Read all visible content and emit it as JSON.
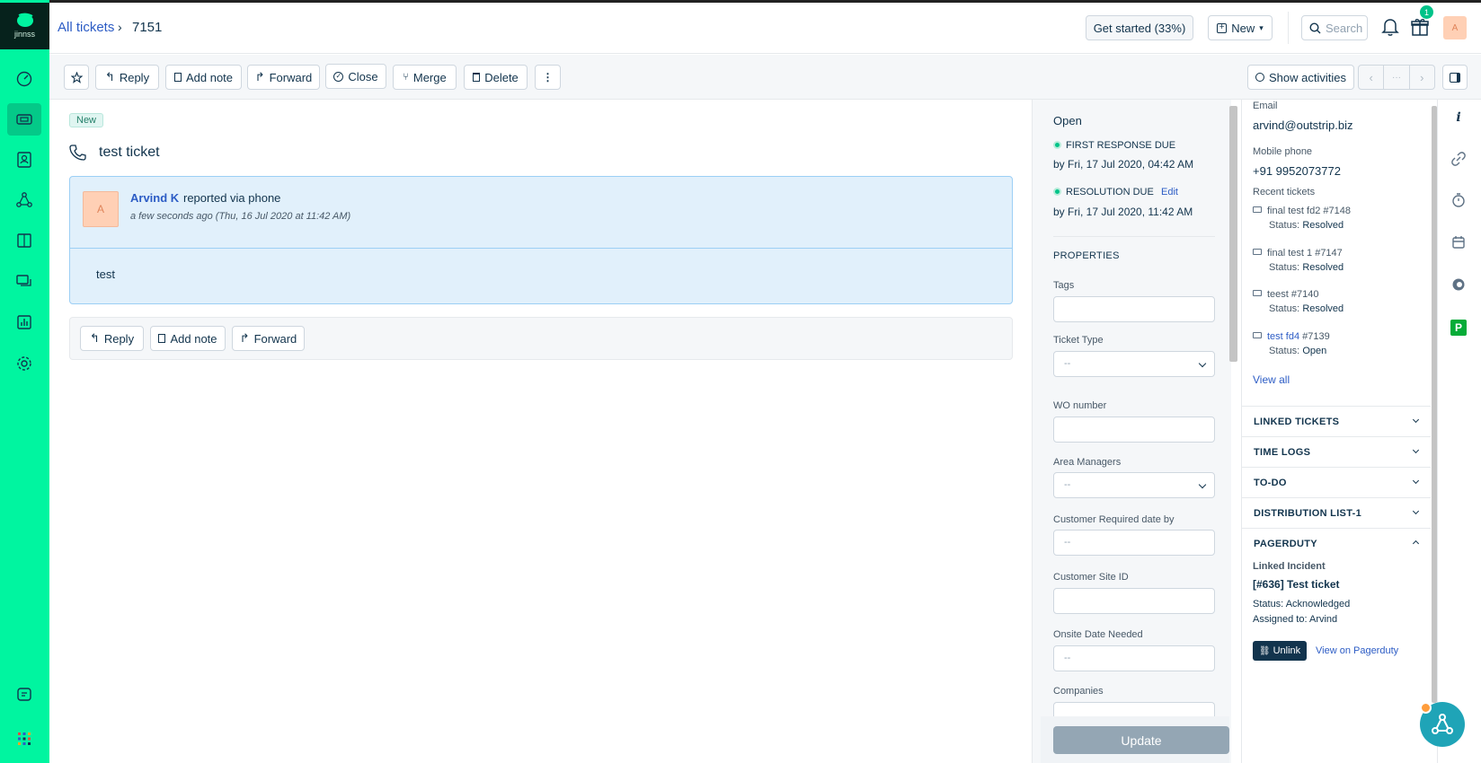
{
  "logo": {
    "text": "jinnss"
  },
  "header": {
    "breadcrumb_root": "All tickets",
    "breadcrumb_current": "7151",
    "get_started": "Get started (33%)",
    "new_label": "New",
    "search_placeholder": "Search",
    "gift_badge": "1",
    "avatar": "A"
  },
  "toolbar": {
    "reply": "Reply",
    "add_note": "Add note",
    "forward": "Forward",
    "close": "Close",
    "merge": "Merge",
    "delete": "Delete",
    "show_activities": "Show activities",
    "pager_middle": "···"
  },
  "ticket": {
    "status_badge": "New",
    "subject": "test ticket",
    "requester": "Arvind K",
    "reported_via": "reported via phone",
    "time": "a few seconds ago (Thu, 16 Jul 2020 at 11:42 AM)",
    "avatar": "A",
    "body": "test"
  },
  "reply_bar": {
    "reply": "Reply",
    "add_note": "Add note",
    "forward": "Forward"
  },
  "properties": {
    "status": "Open",
    "first_response_label": "FIRST RESPONSE DUE",
    "first_response_value": "by Fri, 17 Jul 2020, 04:42 AM",
    "resolution_label": "RESOLUTION DUE",
    "resolution_edit": "Edit",
    "resolution_value": "by Fri, 17 Jul 2020, 11:42 AM",
    "section_title": "PROPERTIES",
    "tags_label": "Tags",
    "ticket_type_label": "Ticket Type",
    "ticket_type_value": "--",
    "wo_label": "WO number",
    "area_label": "Area Managers",
    "area_value": "--",
    "crd_label": "Customer Required date by",
    "crd_value": "--",
    "site_label": "Customer Site ID",
    "onsite_label": "Onsite Date Needed",
    "onsite_value": "--",
    "companies_label": "Companies",
    "update": "Update"
  },
  "contact": {
    "email_label": "Email",
    "email": "arvind@outstrip.biz",
    "mobile_label": "Mobile phone",
    "mobile": "+91 9952073772",
    "recent_label": "Recent tickets",
    "status_prefix": "Status:",
    "recent": [
      {
        "title": "final test fd2 #7148",
        "link": "",
        "id": "",
        "status": "Resolved"
      },
      {
        "title": "final test 1 #7147",
        "link": "",
        "id": "",
        "status": "Resolved"
      },
      {
        "title": "teest #7140",
        "link": "",
        "id": "",
        "status": "Resolved"
      },
      {
        "title": "",
        "link": "test fd4",
        "id": " #7139",
        "status": "Open"
      }
    ],
    "view_all": "View all",
    "sections": [
      "LINKED TICKETS",
      "TIME LOGS",
      "TO-DO",
      "DISTRIBUTION LIST-1",
      "PAGERDUTY"
    ],
    "pagerduty": {
      "linked_label": "Linked Incident",
      "incident": "[#636] Test ticket",
      "status": "Status: Acknowledged",
      "assigned": "Assigned to: Arvind",
      "unlink": "Unlink",
      "view": "View on Pagerduty"
    }
  },
  "rail": {
    "pagerduty_badge": "P"
  },
  "colors": {
    "nav": "#00f5a0",
    "accent": "#2c5cc5",
    "ticket_bg": "#e1f0fb"
  }
}
